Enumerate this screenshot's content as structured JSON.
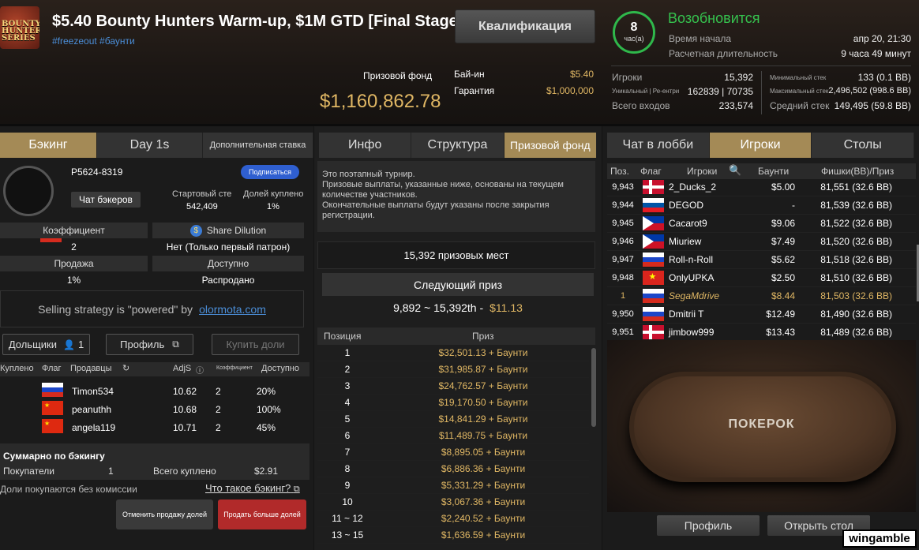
{
  "header": {
    "logo_text": "BOUNTY HUNTERS SERIES",
    "title": "$5.40 Bounty Hunters Warm-up, $1M GTD [Final Stage]",
    "tags": "#freezeout #баунти",
    "qualification_button": "Квалификация",
    "prize_pool_label": "Призовой фонд",
    "prize_pool_value": "$1,160,862.78",
    "buyin_label": "Бай-ин",
    "buyin_value": "$5.40",
    "guarantee_label": "Гарантия",
    "guarantee_value": "$1,000,000",
    "timer_value": "8",
    "timer_unit": "час(а)",
    "status": "Возобновится",
    "start_label": "Время начала",
    "start_value": "апр 20, 21:30",
    "duration_label": "Расчетная длительность",
    "duration_value": "9 часа 49 минут",
    "stats": {
      "players_label": "Игроки",
      "players_value": "15,392",
      "unique_label": "Уникальный | Ре-ентри",
      "unique_value": "162839 | 70735",
      "entries_label": "Всего входов",
      "entries_value": "233,574",
      "min_stack_label": "Минимальный стек",
      "min_stack_value": "133 (0.1 BB)",
      "max_stack_label": "Максимальный стек",
      "max_stack_value": "2,496,502 (998.6 BB)",
      "avg_stack_label": "Средний стек",
      "avg_stack_value": "149,495 (59.8 BB)"
    }
  },
  "left": {
    "tabs": [
      "Бэкинг",
      "Day 1s",
      "Дополнительная ставка"
    ],
    "player_id": "P5624-8319",
    "subscribe_button": "Подписаться",
    "chat_button": "Чат бэкеров",
    "start_stack_label": "Стартовый сте",
    "start_stack_value": "542,409",
    "shares_sold_label": "Долей куплено",
    "shares_sold_value": "1%",
    "coef_label": "Коэффициент",
    "coef_value": "2",
    "share_dilution_label": "Share Dilution",
    "share_dilution_value": "Нет (Только первый патрон)",
    "sale_label": "Продажа",
    "sale_value": "1%",
    "available_label": "Доступно",
    "available_value": "Распродано",
    "strategy_text": "Selling strategy is \"powered\" by",
    "strategy_link": "olormota.com",
    "shareholders_button": "Дольщики",
    "shareholders_count": "1",
    "profile_button": "Профиль",
    "buy_button": "Купить доли",
    "table_headers": [
      "Куплено",
      "Флаг",
      "Продавцы",
      "AdjS",
      "Коэффициент",
      "Доступно"
    ],
    "sellers": [
      {
        "name": "Timon534",
        "adjs": "10.62",
        "coef": "2",
        "avail": "20%",
        "flag": "ru"
      },
      {
        "name": "peanuthh",
        "adjs": "10.68",
        "coef": "2",
        "avail": "100%",
        "flag": "cn"
      },
      {
        "name": "angela119",
        "adjs": "10.71",
        "coef": "2",
        "avail": "45%",
        "flag": "cn"
      }
    ],
    "summary_title": "Суммарно по бэкингу",
    "buyers_label": "Покупатели",
    "buyers_value": "1",
    "total_bought_label": "Всего куплено",
    "total_bought_value": "$2.91",
    "no_commission_text": "Доли покупаются без комиссии",
    "what_is_backing": "Что такое бэкинг?",
    "cancel_sale_button": "Отменить продажу долей",
    "sell_more_button": "Продать больше долей"
  },
  "center": {
    "tabs": [
      "Инфо",
      "Структура",
      "Призовой фонд"
    ],
    "note_lines": [
      "Это поэтапный турнир.",
      "Призовые выплаты, указанные ниже, основаны на текущем",
      "количестве участников.",
      "Окончательные выплаты будут указаны после закрытия",
      "регистрации."
    ],
    "paid_places": "15,392 призовых мест",
    "next_prize_label": "Следующий приз",
    "next_prize_range": "9,892 ~ 15,392th  -",
    "next_prize_value": "$11.13",
    "col_position": "Позиция",
    "col_prize": "Приз",
    "prizes": [
      {
        "pos": "1",
        "prize": "$32,501.13 + Баунти"
      },
      {
        "pos": "2",
        "prize": "$31,985.87 + Баунти"
      },
      {
        "pos": "3",
        "prize": "$24,762.57 + Баунти"
      },
      {
        "pos": "4",
        "prize": "$19,170.50 + Баунти"
      },
      {
        "pos": "5",
        "prize": "$14,841.29 + Баунти"
      },
      {
        "pos": "6",
        "prize": "$11,489.75 + Баунти"
      },
      {
        "pos": "7",
        "prize": "$8,895.05 + Баунти"
      },
      {
        "pos": "8",
        "prize": "$6,886.36 + Баунти"
      },
      {
        "pos": "9",
        "prize": "$5,331.29 + Баунти"
      },
      {
        "pos": "10",
        "prize": "$3,067.36 + Баунти"
      },
      {
        "pos": "11 ~ 12",
        "prize": "$2,240.52 + Баунти"
      },
      {
        "pos": "13 ~ 15",
        "prize": "$1,636.59 + Баунти"
      }
    ]
  },
  "right": {
    "tabs": [
      "Чат в лобби",
      "Игроки",
      "Столы"
    ],
    "table_headers": [
      "Поз.",
      "Флаг",
      "Игроки",
      "Баунти",
      "Фишки(BB)/Приз"
    ],
    "players": [
      {
        "pos": "9,943",
        "flag": "dk",
        "name": "2_Ducks_2",
        "bounty": "$5.00",
        "chips": "81,551 (32.6 BB)"
      },
      {
        "pos": "9,944",
        "flag": "si",
        "name": "DEGOD",
        "bounty": "-",
        "chips": "81,539 (32.6 BB)"
      },
      {
        "pos": "9,945",
        "flag": "ph",
        "name": "Cacarot9",
        "bounty": "$9.06",
        "chips": "81,522 (32.6 BB)"
      },
      {
        "pos": "9,946",
        "flag": "ph",
        "name": "Miuriew",
        "bounty": "$7.49",
        "chips": "81,520 (32.6 BB)"
      },
      {
        "pos": "9,947",
        "flag": "ru",
        "name": "Roll-n-Roll",
        "bounty": "$5.62",
        "chips": "81,518 (32.6 BB)"
      },
      {
        "pos": "9,948",
        "flag": "vn",
        "name": "OnlyUPKA",
        "bounty": "$2.50",
        "chips": "81,510 (32.6 BB)"
      },
      {
        "pos": "1",
        "flag": "ru",
        "name": "SegaMdrive",
        "bounty": "$8.44",
        "chips": "81,503 (32.6 BB)"
      },
      {
        "pos": "9,950",
        "flag": "ru",
        "name": "Dmitrii T",
        "bounty": "$12.49",
        "chips": "81,490 (32.6 BB)"
      },
      {
        "pos": "9,951",
        "flag": "dk",
        "name": "jimbow999",
        "bounty": "$13.43",
        "chips": "81,489 (32.6 BB)"
      }
    ],
    "table_brand": "ПОКЕРОК",
    "profile_button": "Профиль",
    "open_table_button": "Открыть стол",
    "watermark": "wingamble"
  }
}
